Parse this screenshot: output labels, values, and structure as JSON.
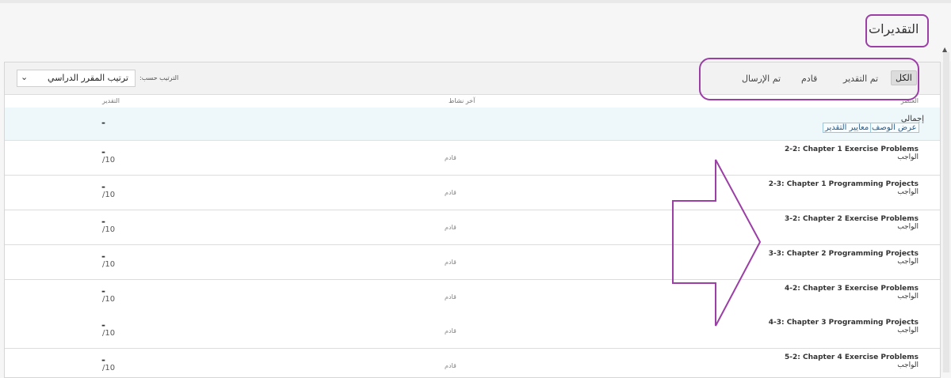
{
  "page": {
    "title": "التقديرات"
  },
  "toolbar": {
    "filters": [
      "الكل",
      "تم التقدير",
      "قادم",
      "تم الإرسال"
    ],
    "active_filter": "الكل",
    "sort_label": "الترتيب حسب:",
    "sort_value": "ترتيب المقرر الدراسي"
  },
  "columns": {
    "item": "العنصر",
    "last_activity": "آخر نشاط",
    "grade": "التقدير"
  },
  "summary": {
    "label": "إجمالي",
    "view_description": "عرض الوصف",
    "grading_criteria": "معايير التقدير",
    "grade": "-"
  },
  "rows": [
    {
      "title": "2-2: Chapter 1 Exercise Problems",
      "type": "الواجب",
      "status": "قادم",
      "grade": "-",
      "max": "/10"
    },
    {
      "title": "2-3: Chapter 1 Programming Projects",
      "type": "الواجب",
      "status": "قادم",
      "grade": "-",
      "max": "/10"
    },
    {
      "title": "3-2: Chapter 2 Exercise Problems",
      "type": "الواجب",
      "status": "قادم",
      "grade": "-",
      "max": "/10"
    },
    {
      "title": "3-3: Chapter 2 Programming Projects",
      "type": "الواجب",
      "status": "قادم",
      "grade": "-",
      "max": "/10"
    },
    {
      "title": "4-2: Chapter 3 Exercise Problems",
      "type": "الواجب",
      "status": "قادم",
      "grade": "-",
      "max": "/10"
    },
    {
      "title": "4-3: Chapter 3 Programming Projects",
      "type": "الواجب",
      "status": "قادم",
      "grade": "-",
      "max": "/10"
    },
    {
      "title": "5-2: Chapter 4 Exercise Problems",
      "type": "الواجب",
      "status": "قادم",
      "grade": "-",
      "max": "/10"
    }
  ],
  "colors": {
    "annotation": "#9b3ea6",
    "link": "#2a5f8f",
    "summary_bg": "#eef8fb"
  }
}
